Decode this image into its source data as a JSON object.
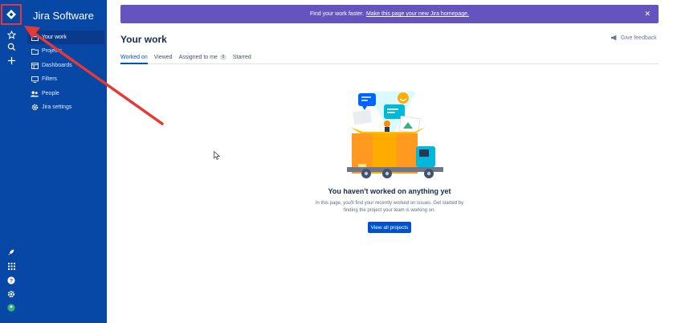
{
  "app": {
    "product_name": "Jira Software"
  },
  "sidebar": {
    "items": [
      {
        "label": "Your work",
        "icon": "work-icon",
        "active": true
      },
      {
        "label": "Projects",
        "icon": "folder-icon",
        "active": false
      },
      {
        "label": "Dashboards",
        "icon": "dashboard-icon",
        "active": false
      },
      {
        "label": "Filters",
        "icon": "filter-icon",
        "active": false
      },
      {
        "label": "People",
        "icon": "people-icon",
        "active": false
      },
      {
        "label": "Jira settings",
        "icon": "gear-icon",
        "active": false
      }
    ]
  },
  "banner": {
    "text": "Find your work faster.",
    "link": "Make this page your new Jira homepage.",
    "close_icon": "close-icon"
  },
  "main": {
    "title": "Your work",
    "feedback_label": "Give feedback",
    "tabs": [
      {
        "label": "Worked on",
        "active": true
      },
      {
        "label": "Viewed",
        "active": false
      },
      {
        "label": "Assigned to me",
        "badge": "0",
        "active": false
      },
      {
        "label": "Starred",
        "active": false
      }
    ],
    "empty_state": {
      "title": "You haven't worked on anything yet",
      "description": "In this page, you'll find your recently worked on issues. Get started by finding the project your team is working on.",
      "button_label": "View all projects"
    }
  },
  "colors": {
    "sidebar": "#0747a6",
    "banner": "#6554c0",
    "primary": "#0052cc",
    "annotation": "#e53935"
  }
}
